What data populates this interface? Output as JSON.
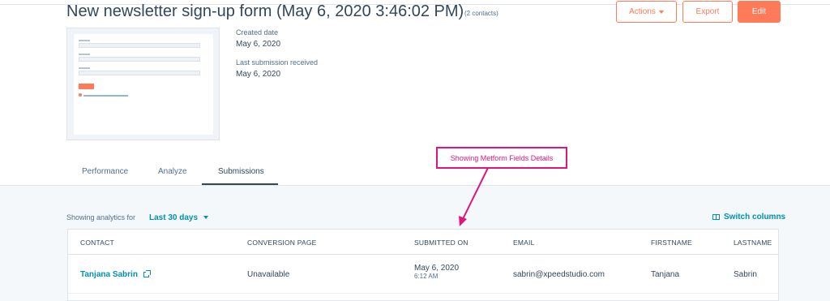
{
  "header": {
    "title": "New newsletter sign-up form (May 6, 2020 3:46:02 PM)",
    "contacts_count": "(2 contacts)",
    "actions_label": "Actions",
    "export_label": "Export",
    "edit_label": "Edit"
  },
  "meta": {
    "created_label": "Created date",
    "created_value": "May 6, 2020",
    "last_submission_label": "Last submission received",
    "last_submission_value": "May 6, 2020"
  },
  "tabs": [
    {
      "label": "Performance",
      "active": false
    },
    {
      "label": "Analyze",
      "active": false
    },
    {
      "label": "Submissions",
      "active": true
    }
  ],
  "annotation": {
    "text": "Showing Metform Fields Details",
    "color": "#e0167f"
  },
  "analytics": {
    "showing_label": "Showing analytics for",
    "range": "Last 30 days",
    "switch_columns": "Switch columns"
  },
  "table": {
    "columns": [
      "CONTACT",
      "CONVERSION PAGE",
      "SUBMITTED ON",
      "EMAIL",
      "FIRSTNAME",
      "LASTNAME"
    ],
    "rows": [
      {
        "contact": "Tanjana Sabrin",
        "conversion_page": "Unavailable",
        "submitted_date": "May 6, 2020",
        "submitted_time": "6:12 AM",
        "email": "sabrin@xpeedstudio.com",
        "firstname": "Tanjana",
        "lastname": "Sabrin"
      }
    ]
  },
  "colors": {
    "accent": "#ff7a59",
    "link": "#0091ae",
    "text": "#33475b"
  }
}
